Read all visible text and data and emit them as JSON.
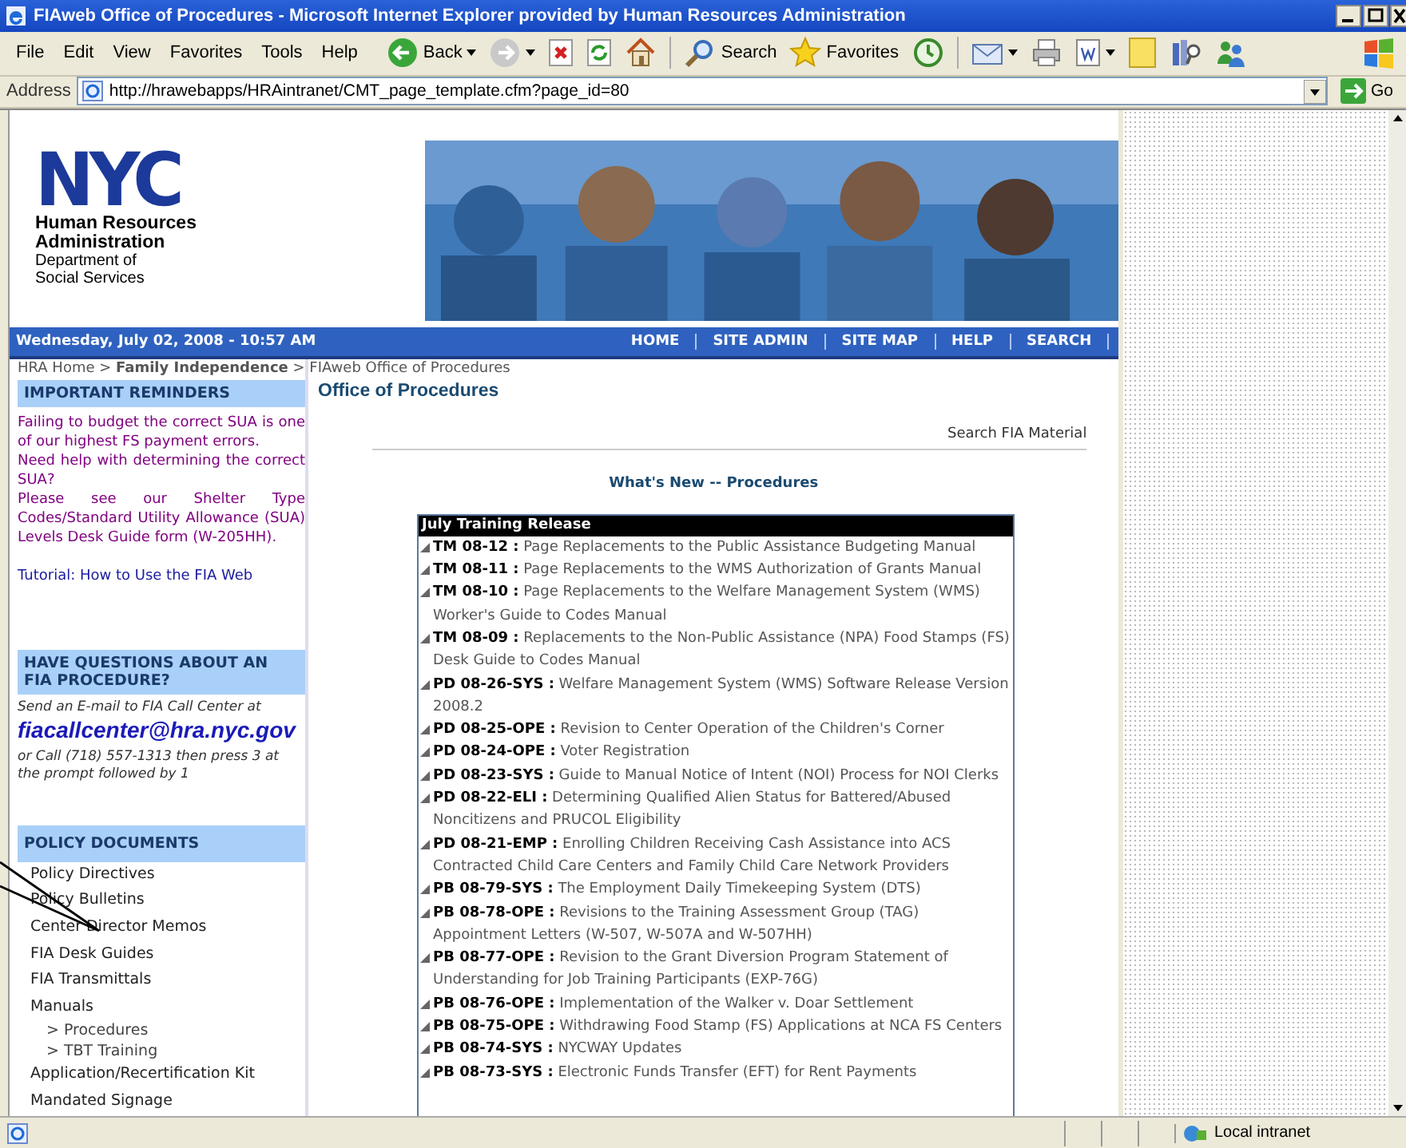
{
  "window": {
    "title": "FIAweb Office of Procedures - Microsoft Internet Explorer provided by Human Resources Administration"
  },
  "menu": [
    "File",
    "Edit",
    "View",
    "Favorites",
    "Tools",
    "Help"
  ],
  "toolbar": [
    {
      "kind": "back",
      "label": "Back",
      "dropdown": true
    },
    {
      "kind": "forward",
      "dropdown": true
    },
    {
      "kind": "stop"
    },
    {
      "kind": "refresh"
    },
    {
      "kind": "home"
    },
    {
      "kind": "separator"
    },
    {
      "kind": "search",
      "label": "Search"
    },
    {
      "kind": "favorites",
      "label": "Favorites"
    },
    {
      "kind": "history"
    },
    {
      "kind": "separator"
    },
    {
      "kind": "mail",
      "dropdown": true
    },
    {
      "kind": "print"
    },
    {
      "kind": "word",
      "dropdown": true
    },
    {
      "kind": "note"
    },
    {
      "kind": "research"
    },
    {
      "kind": "messenger"
    }
  ],
  "address": {
    "label": "Address",
    "url": "http://hrawebapps/HRAintranet/CMT_page_template.cfm?page_id=80",
    "go": "Go"
  },
  "header": {
    "logo": {
      "mark": "NYC",
      "org": [
        "Human Resources",
        "Administration"
      ],
      "dept": [
        "Department of",
        "Social Services"
      ]
    },
    "date": "Wednesday, July 02, 2008 - 10:57 AM",
    "nav": [
      "HOME",
      "SITE ADMIN",
      "SITE MAP",
      "HELP",
      "SEARCH"
    ]
  },
  "breadcrumb": "HRA Home > **Family Independence** > FIAweb Office of Procedures",
  "sidebar": {
    "reminders": {
      "heading": "IMPORTANT REMINDERS",
      "paragraphs": [
        "Failing to budget the correct SUA is one of our highest FS payment errors.",
        "Need help with determining the correct SUA?",
        "Please see our Shelter Type Codes/Standard Utility Allowance (SUA) Levels Desk Guide form (W-205HH)."
      ],
      "tutorial": "Tutorial: How to Use the FIA Web"
    },
    "questions": {
      "heading": "HAVE QUESTIONS ABOUT AN FIA PROCEDURE?",
      "intro": "Send an E-mail to FIA Call Center at",
      "email": "fiacallcenter@hra.nyc.gov",
      "call": "or Call (718) 557-1313 then press 3 at the prompt followed by 1"
    },
    "policy": {
      "heading": "POLICY DOCUMENTS",
      "items": [
        {
          "label": "Policy Directives"
        },
        {
          "label": "Policy Bulletins"
        },
        {
          "label": "Center Director Memos"
        },
        {
          "label": "FIA Desk Guides"
        },
        {
          "label": "FIA Transmittals"
        },
        {
          "label": "Manuals",
          "children": [
            {
              "label": "> Procedures"
            },
            {
              "label": "> TBT Training"
            }
          ]
        },
        {
          "label": "Application/Recertification Kit"
        },
        {
          "label": "Mandated Signage"
        }
      ]
    }
  },
  "main": {
    "title": "Office of Procedures",
    "search_link": "Search FIA Material",
    "whats_new": "What's New -- Procedures",
    "box": {
      "heading": "July Training Release",
      "items": [
        {
          "code": "TM 08-12 :",
          "text": "Page Replacements to the Public Assistance Budgeting Manual"
        },
        {
          "code": "TM 08-11 :",
          "text": "Page Replacements to the WMS Authorization of Grants Manual"
        },
        {
          "code": "TM 08-10 :",
          "text": "Page Replacements to the Welfare Management System (WMS) Worker's Guide to Codes Manual"
        },
        {
          "code": "TM 08-09 :",
          "text": "Replacements to the Non-Public Assistance (NPA) Food Stamps (FS) Desk Guide to Codes Manual"
        },
        {
          "code": "PD 08-26-SYS :",
          "text": "Welfare Management System (WMS) Software Release Version 2008.2"
        },
        {
          "code": "PD 08-25-OPE :",
          "text": "Revision to Center Operation of the Children's Corner"
        },
        {
          "code": "PD 08-24-OPE :",
          "text": "Voter Registration"
        },
        {
          "code": "PD 08-23-SYS :",
          "text": "Guide to Manual Notice of Intent (NOI) Process for NOI Clerks"
        },
        {
          "code": "PD 08-22-ELI :",
          "text": "Determining Qualified Alien Status for Battered/Abused Noncitizens and PRUCOL Eligibility"
        },
        {
          "code": "PD 08-21-EMP :",
          "text": "Enrolling Children Receiving Cash Assistance into ACS Contracted Child Care Centers and Family Child Care Network Providers"
        },
        {
          "code": "PB 08-79-SYS :",
          "text": "The Employment Daily Timekeeping System (DTS)"
        },
        {
          "code": "PB 08-78-OPE :",
          "text": "Revisions to the Training Assessment Group (TAG) Appointment Letters (W-507, W-507A and W-507HH)"
        },
        {
          "code": "PB 08-77-OPE :",
          "text": "Revision to the Grant Diversion Program Statement of Understanding for Job Training Participants (EXP-76G)"
        },
        {
          "code": "PB 08-76-OPE :",
          "text": "Implementation of the Walker v. Doar Settlement"
        },
        {
          "code": "PB 08-75-OPE :",
          "text": "Withdrawing Food Stamp (FS) Applications at NCA FS Centers"
        },
        {
          "code": "PB 08-74-SYS :",
          "text": "NYCWAY Updates"
        },
        {
          "code": "PB 08-73-SYS :",
          "text": "Electronic Funds Transfer (EFT) for Rent Payments"
        }
      ]
    }
  },
  "status_bar": {
    "zone": "Local intranet"
  }
}
